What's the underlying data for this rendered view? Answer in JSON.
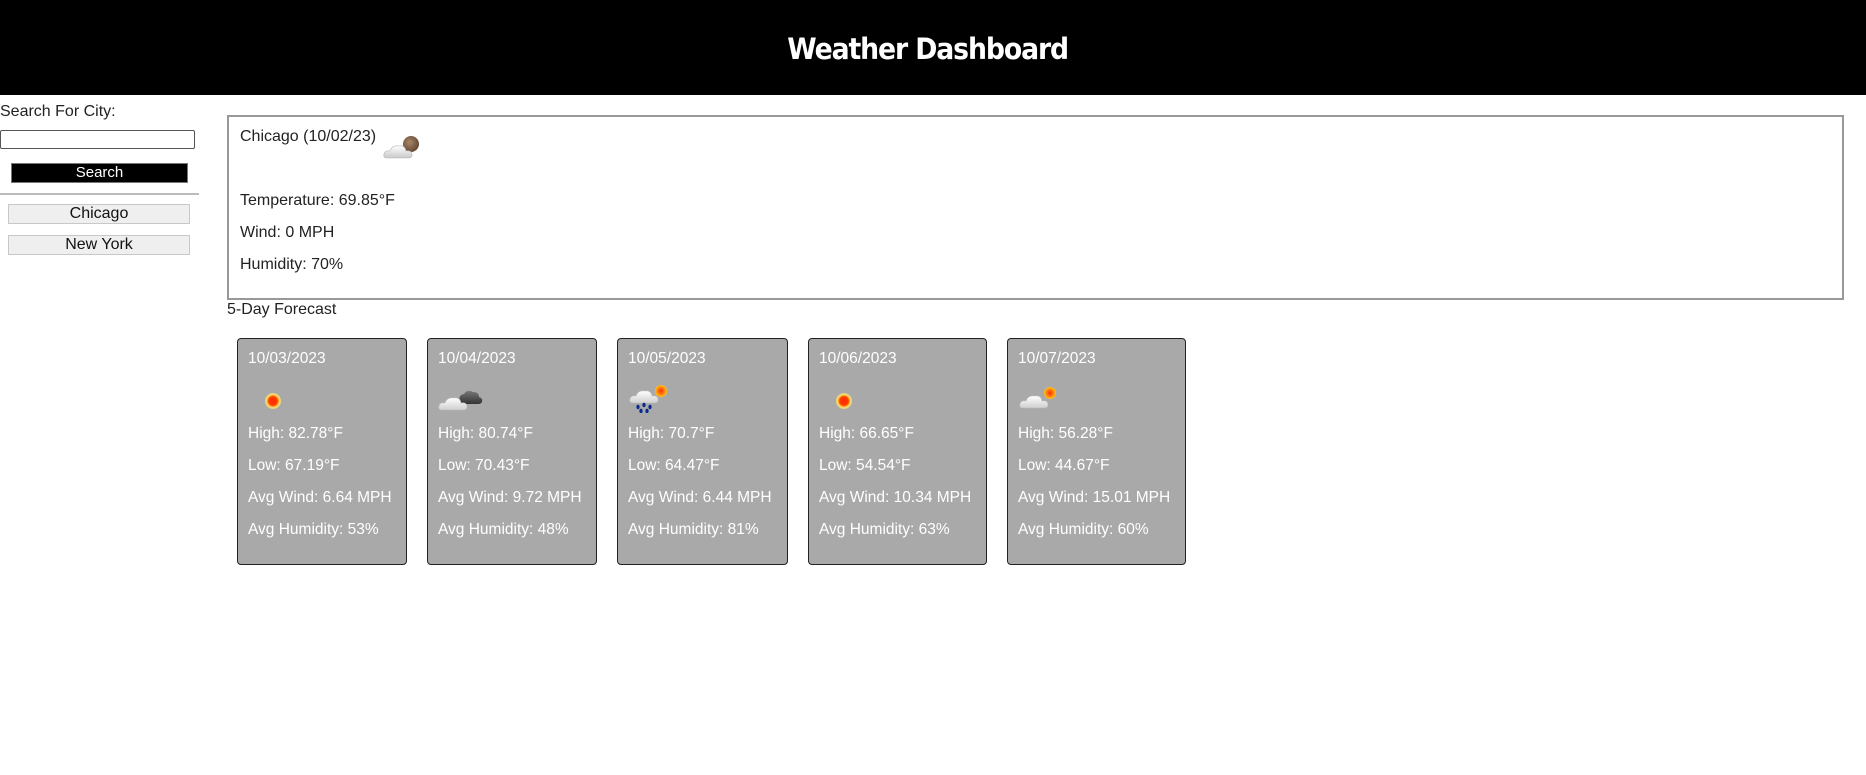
{
  "header": {
    "title": "Weather Dashboard"
  },
  "sidebar": {
    "search_label": "Search For City:",
    "search_value": "",
    "search_placeholder": "",
    "search_button": "Search",
    "history": [
      "Chicago",
      "New York"
    ]
  },
  "current": {
    "title": "Chicago (10/02/23)",
    "icon": "partly-cloudy-night-icon",
    "temperature": "Temperature: 69.85°F",
    "wind": "Wind: 0 MPH",
    "humidity": "Humidity: 70%"
  },
  "forecast": {
    "heading": "5-Day Forecast",
    "days": [
      {
        "date": "10/03/2023",
        "icon": "sun-icon",
        "high": "High: 82.78°F",
        "low": "Low: 67.19°F",
        "wind": "Avg Wind: 6.64 MPH",
        "humidity": "Avg Humidity: 53%"
      },
      {
        "date": "10/04/2023",
        "icon": "broken-clouds-icon",
        "high": "High: 80.74°F",
        "low": "Low: 70.43°F",
        "wind": "Avg Wind: 9.72 MPH",
        "humidity": "Avg Humidity: 48%"
      },
      {
        "date": "10/05/2023",
        "icon": "rain-sun-icon",
        "high": "High: 70.7°F",
        "low": "Low: 64.47°F",
        "wind": "Avg Wind: 6.44 MPH",
        "humidity": "Avg Humidity: 81%"
      },
      {
        "date": "10/06/2023",
        "icon": "sun-icon",
        "high": "High: 66.65°F",
        "low": "Low: 54.54°F",
        "wind": "Avg Wind: 10.34 MPH",
        "humidity": "Avg Humidity: 63%"
      },
      {
        "date": "10/07/2023",
        "icon": "partly-cloudy-day-icon",
        "high": "High: 56.28°F",
        "low": "Low: 44.67°F",
        "wind": "Avg Wind: 15.01 MPH",
        "humidity": "Avg Humidity: 60%"
      }
    ]
  },
  "colors": {
    "header_bg": "#000000",
    "card_bg": "#a9a9a9",
    "button_bg": "#000000"
  }
}
